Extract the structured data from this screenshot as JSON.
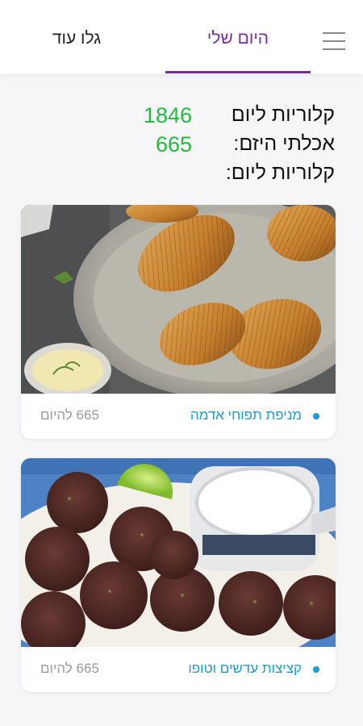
{
  "header": {
    "tabs": [
      {
        "label": "היום שלי",
        "active": true
      },
      {
        "label": "גלו עוד",
        "active": false
      }
    ],
    "accent_color": "#7a2aa8",
    "menu_icon": "hamburger-menu-icon"
  },
  "stats": {
    "value_color": "#1fbf3a",
    "rows": [
      {
        "label": "קלוריות ליום",
        "value": "1846"
      },
      {
        "label": "אכלתי היזם:",
        "value": "665"
      },
      {
        "label": "קלוריות ליום:",
        "value": ""
      }
    ]
  },
  "recipes": [
    {
      "title": "מניפת תפוחי אדמה",
      "calories": "665 להיום",
      "image": "hasselback-potatoes-photo"
    },
    {
      "title": "קציצות עדשים וטופו",
      "calories": "665 להיום",
      "image": "lentil-tofu-patties-photo"
    }
  ],
  "colors": {
    "link": "#1b9bd7",
    "muted": "#9a9a9a"
  }
}
